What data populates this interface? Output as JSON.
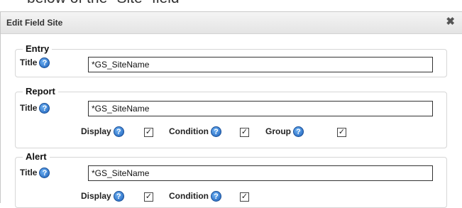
{
  "caption": "below of the \"Site\" field",
  "dialog": {
    "title": "Edit Field Site",
    "close_icon": "close-icon"
  },
  "entry": {
    "legend": "Entry",
    "title_label": "Title",
    "title_value": "*GS_SiteName"
  },
  "report": {
    "legend": "Report",
    "title_label": "Title",
    "title_value": "*GS_SiteName",
    "display_label": "Display",
    "condition_label": "Condition",
    "group_label": "Group",
    "display_checked": true,
    "condition_checked": true,
    "group_checked": true
  },
  "alert": {
    "legend": "Alert",
    "title_label": "Title",
    "title_value": "*GS_SiteName",
    "display_label": "Display",
    "condition_label": "Condition",
    "display_checked": true,
    "condition_checked": true
  },
  "icons": {
    "help": "help-icon",
    "check": "checkmark-icon"
  },
  "colors": {
    "help_icon": "#1c5fb8",
    "titlebar": "#e8e8e8"
  }
}
